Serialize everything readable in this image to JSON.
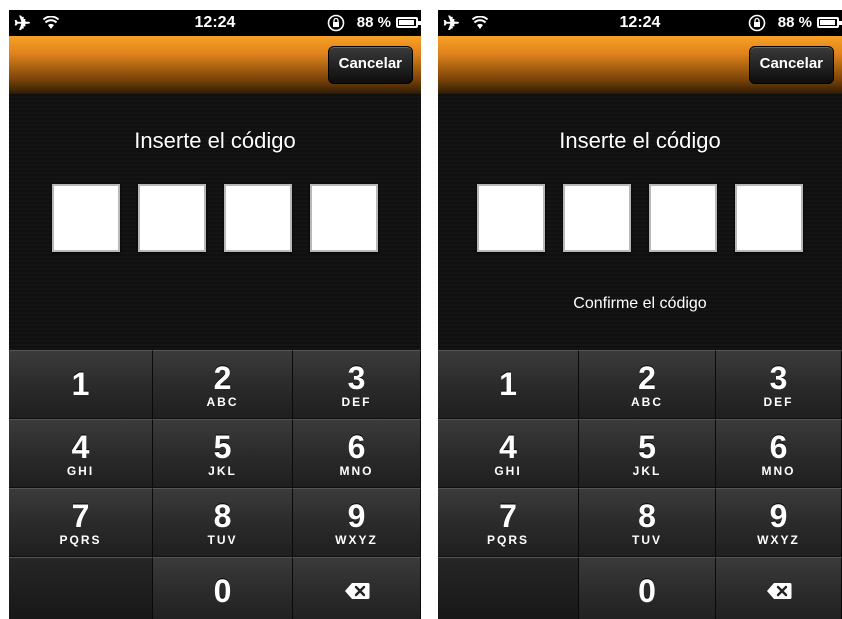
{
  "status_bar": {
    "time": "12:24",
    "battery_percent": "88 %",
    "icons": [
      "airplane-icon",
      "wifi-icon",
      "rotation-lock-icon",
      "battery-charging-icon"
    ]
  },
  "nav": {
    "cancel_label": "Cancelar"
  },
  "screens": [
    {
      "prompt": "Inserte el código",
      "confirm_text": ""
    },
    {
      "prompt": "Inserte el código",
      "confirm_text": "Confirme el código"
    }
  ],
  "keypad": [
    {
      "digit": "1",
      "letters": ""
    },
    {
      "digit": "2",
      "letters": "ABC"
    },
    {
      "digit": "3",
      "letters": "DEF"
    },
    {
      "digit": "4",
      "letters": "GHI"
    },
    {
      "digit": "5",
      "letters": "JKL"
    },
    {
      "digit": "6",
      "letters": "MNO"
    },
    {
      "digit": "7",
      "letters": "PQRS"
    },
    {
      "digit": "8",
      "letters": "TUV"
    },
    {
      "digit": "9",
      "letters": "WXYZ"
    },
    {
      "digit": "",
      "letters": ""
    },
    {
      "digit": "0",
      "letters": ""
    },
    {
      "digit": "",
      "letters": "",
      "icon": "delete-backspace-icon"
    }
  ],
  "colors": {
    "nav_orange": "#f7a126",
    "background": "#101010",
    "key": "#2b2b2b"
  }
}
